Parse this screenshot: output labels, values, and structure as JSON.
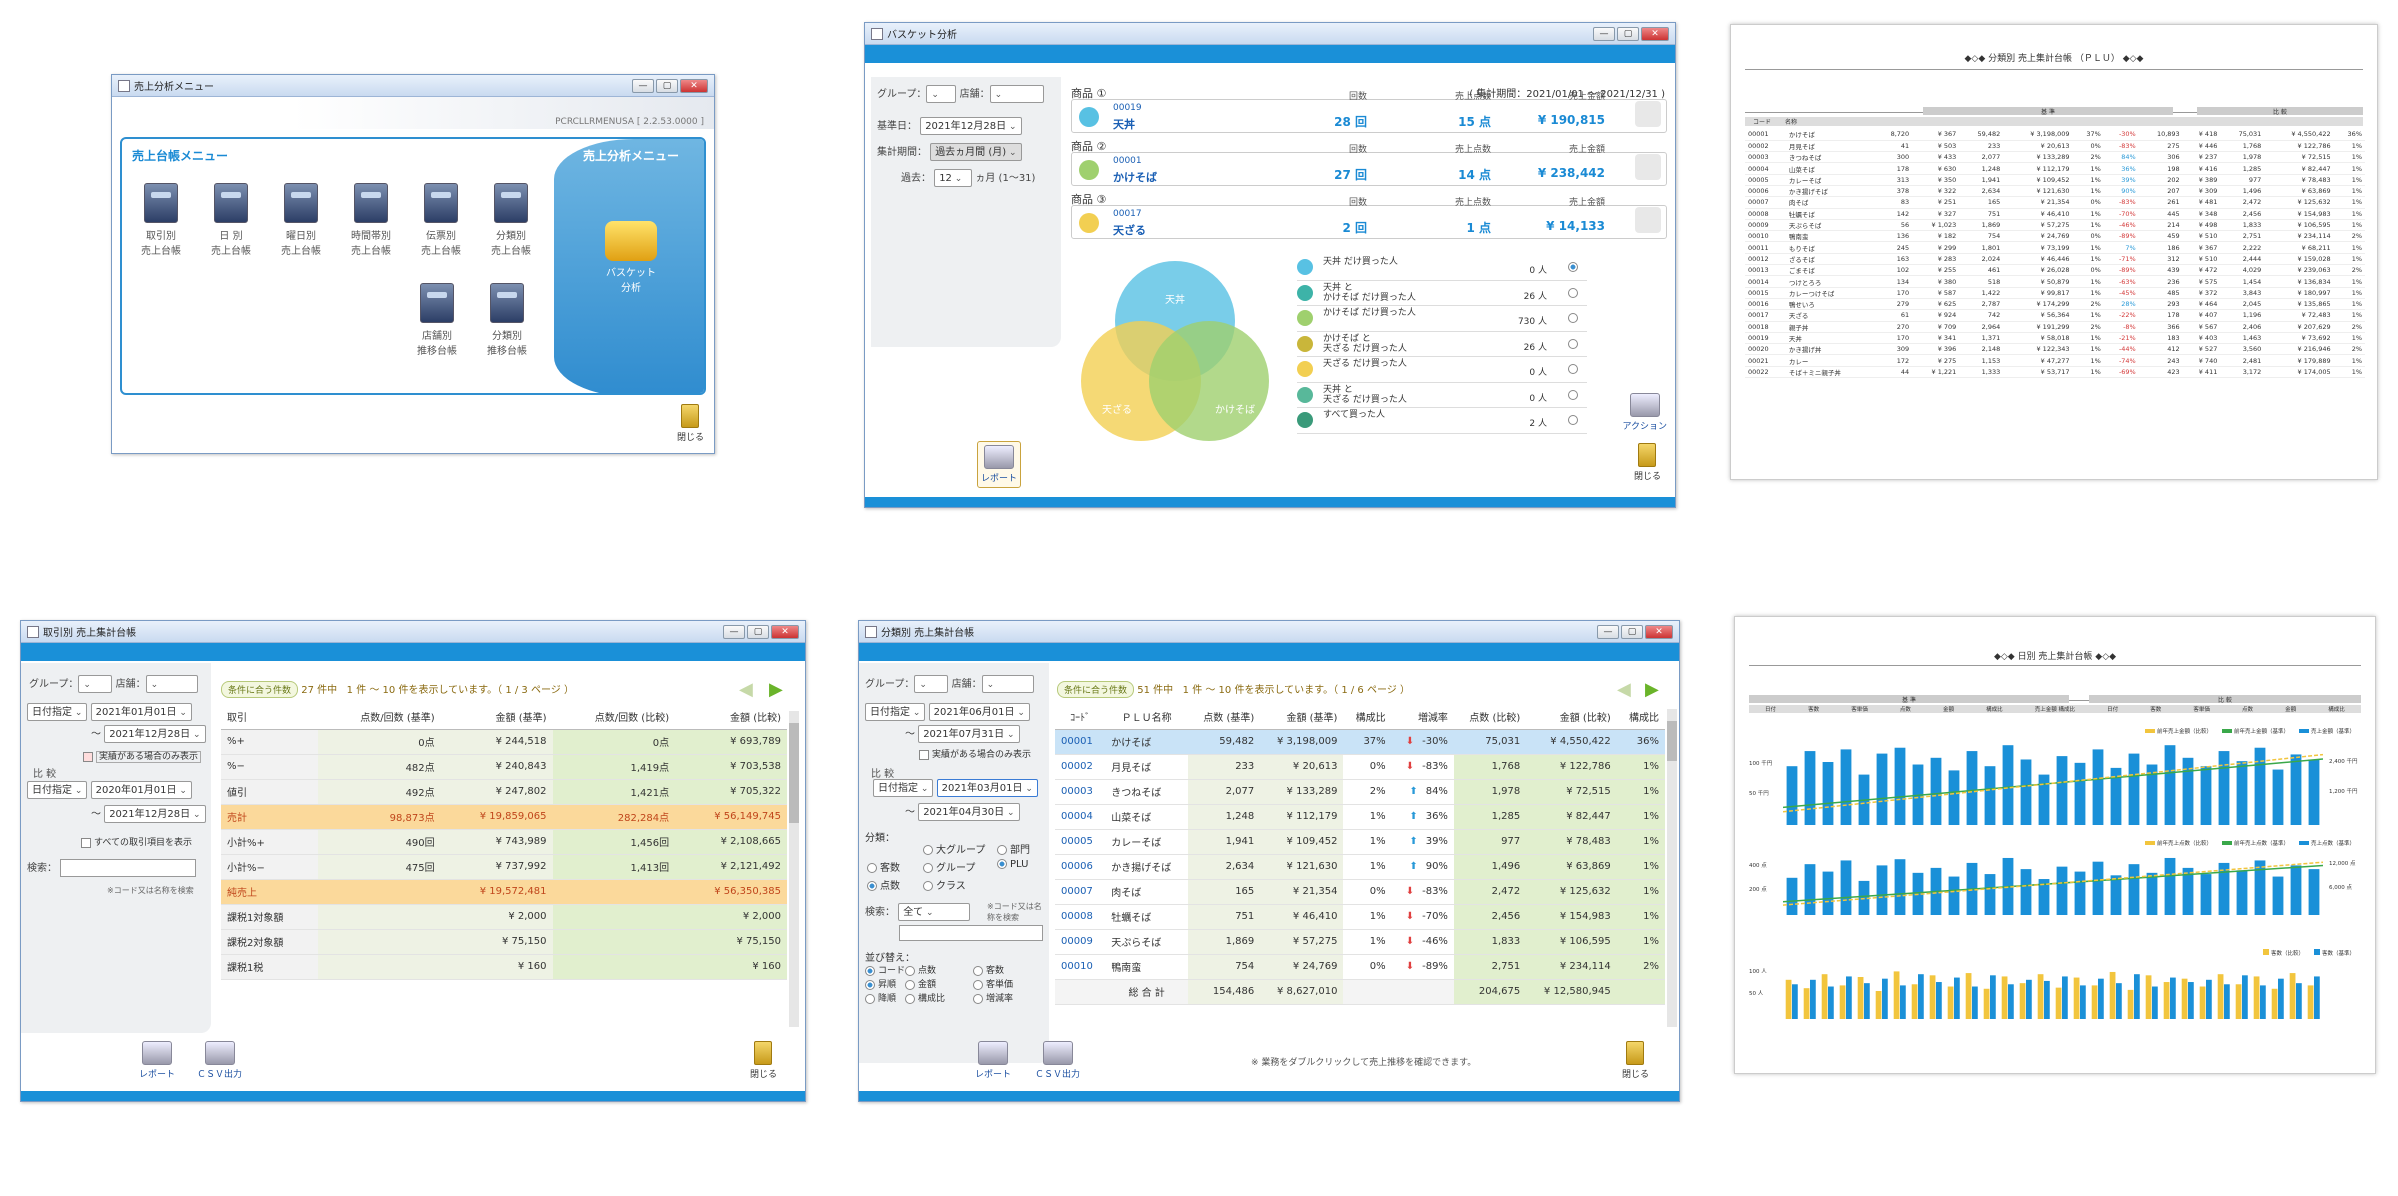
{
  "menu": {
    "title": "売上分析メニュー",
    "version": "PCRCLLRMENUSA [ 2.2.53.0000 ]",
    "section_left": "売上台帳メニュー",
    "section_right": "売上分析メニュー",
    "icons": [
      {
        "l1": "取引別",
        "l2": "売上台帳"
      },
      {
        "l1": "日 別",
        "l2": "売上台帳"
      },
      {
        "l1": "曜日別",
        "l2": "売上台帳"
      },
      {
        "l1": "時間帯別",
        "l2": "売上台帳"
      },
      {
        "l1": "伝票別",
        "l2": "売上台帳"
      },
      {
        "l1": "分類別",
        "l2": "売上台帳"
      }
    ],
    "icons2": [
      {
        "l1": "店舗別",
        "l2": "推移台帳"
      },
      {
        "l1": "分類別",
        "l2": "推移台帳"
      }
    ],
    "basket_l1": "バスケット",
    "basket_l2": "分析",
    "close": "閉じる"
  },
  "basket": {
    "title": "バスケット分析",
    "group": "グループ：",
    "store": "店舗：",
    "base_date_label": "基準日：",
    "base_date": "2021年12月28日",
    "period_label": "集計期間：",
    "period": "過去ヵ月間 (月)",
    "past_label": "過去：",
    "past_value": "12",
    "past_unit": "ヵ月 (1～31)",
    "range": "( 集計期間：2021/01/01 ～ 2021/12/31 )",
    "products": [
      {
        "head": "商品 ①",
        "code": "00019",
        "name": "天丼",
        "k1": "回数",
        "v1": "28 回",
        "k2": "売上点数",
        "v2": "15 点",
        "k3": "売上金額",
        "v3": "¥ 190,815",
        "color": "#58c1e3"
      },
      {
        "head": "商品 ②",
        "code": "00001",
        "name": "かけそば",
        "k1": "回数",
        "v1": "27 回",
        "k2": "売上点数",
        "v2": "14 点",
        "k3": "売上金額",
        "v3": "¥ 238,442",
        "color": "#9fd06e"
      },
      {
        "head": "商品 ③",
        "code": "00017",
        "name": "天ざる",
        "k1": "回数",
        "v1": "2 回",
        "k2": "売上点数",
        "v2": "1 点",
        "k3": "売上金額",
        "v3": "¥ 14,133",
        "color": "#f2cf52"
      }
    ],
    "venn": [
      "天丼",
      "天ざる",
      "かけそば"
    ],
    "rows": [
      {
        "label": "天丼 だけ買った人",
        "count": "0 人",
        "color": "#58c1e3"
      },
      {
        "label": "天丼 と\nかけそば だけ買った人",
        "count": "26 人",
        "color": "#3db3a8"
      },
      {
        "label": "かけそば だけ買った人",
        "count": "730 人",
        "color": "#9fd06e"
      },
      {
        "label": "かけそば と\n天ざる だけ買った人",
        "count": "26 人",
        "color": "#c9b63a"
      },
      {
        "label": "天ざる だけ買った人",
        "count": "0 人",
        "color": "#f2cf52"
      },
      {
        "label": "天丼 と\n天ざる だけ買った人",
        "count": "0 人",
        "color": "#58b89a"
      },
      {
        "label": "すべて買った人",
        "count": "2 人",
        "color": "#3a9a7a"
      }
    ],
    "action": "アクション",
    "report": "レポート",
    "close": "閉じる"
  },
  "plu_report": {
    "title": "◆◇◆ 分類別 売上集計台帳 （ＰＬＵ） ◆◇◆",
    "hdr_base": "基 準",
    "hdr_comp": "比 較",
    "cols": [
      "コード",
      "名称"
    ],
    "rows": [
      [
        "00001",
        "かけそば",
        "8,720",
        "¥ 367",
        "59,482",
        "¥ 3,198,009",
        "37%",
        "-30%",
        "10,893",
        "¥ 418",
        "75,031",
        "¥ 4,550,422",
        "36%"
      ],
      [
        "00002",
        "月見そば",
        "41",
        "¥ 503",
        "233",
        "¥ 20,613",
        "0%",
        "-83%",
        "275",
        "¥ 446",
        "1,768",
        "¥ 122,786",
        "1%"
      ],
      [
        "00003",
        "きつねそば",
        "300",
        "¥ 433",
        "2,077",
        "¥ 133,289",
        "2%",
        "84%",
        "306",
        "¥ 237",
        "1,978",
        "¥ 72,515",
        "1%"
      ],
      [
        "00004",
        "山菜そば",
        "178",
        "¥ 630",
        "1,248",
        "¥ 112,179",
        "1%",
        "36%",
        "198",
        "¥ 416",
        "1,285",
        "¥ 82,447",
        "1%"
      ],
      [
        "00005",
        "カレーそば",
        "313",
        "¥ 350",
        "1,941",
        "¥ 109,452",
        "1%",
        "39%",
        "202",
        "¥ 389",
        "977",
        "¥ 78,483",
        "1%"
      ],
      [
        "00006",
        "かき揚げそば",
        "378",
        "¥ 322",
        "2,634",
        "¥ 121,630",
        "1%",
        "90%",
        "207",
        "¥ 309",
        "1,496",
        "¥ 63,869",
        "1%"
      ],
      [
        "00007",
        "肉そば",
        "83",
        "¥ 251",
        "165",
        "¥ 21,354",
        "0%",
        "-83%",
        "261",
        "¥ 481",
        "2,472",
        "¥ 125,632",
        "1%"
      ],
      [
        "00008",
        "牡蠣そば",
        "142",
        "¥ 327",
        "751",
        "¥ 46,410",
        "1%",
        "-70%",
        "445",
        "¥ 348",
        "2,456",
        "¥ 154,983",
        "1%"
      ],
      [
        "00009",
        "天ぷらそば",
        "56",
        "¥ 1,023",
        "1,869",
        "¥ 57,275",
        "1%",
        "-46%",
        "214",
        "¥ 498",
        "1,833",
        "¥ 106,595",
        "1%"
      ],
      [
        "00010",
        "鴨南蛮",
        "136",
        "¥ 182",
        "754",
        "¥ 24,769",
        "0%",
        "-89%",
        "459",
        "¥ 510",
        "2,751",
        "¥ 234,114",
        "2%"
      ],
      [
        "00011",
        "もりそば",
        "245",
        "¥ 299",
        "1,801",
        "¥ 73,199",
        "1%",
        "7%",
        "186",
        "¥ 367",
        "2,222",
        "¥ 68,211",
        "1%"
      ],
      [
        "00012",
        "ざるそば",
        "163",
        "¥ 283",
        "2,024",
        "¥ 46,446",
        "1%",
        "-71%",
        "312",
        "¥ 510",
        "2,444",
        "¥ 159,028",
        "1%"
      ],
      [
        "00013",
        "ごまそば",
        "102",
        "¥ 255",
        "461",
        "¥ 26,028",
        "0%",
        "-89%",
        "439",
        "¥ 472",
        "4,029",
        "¥ 239,063",
        "2%"
      ],
      [
        "00014",
        "つけとろろ",
        "134",
        "¥ 380",
        "518",
        "¥ 50,879",
        "1%",
        "-63%",
        "236",
        "¥ 575",
        "1,454",
        "¥ 136,834",
        "1%"
      ],
      [
        "00015",
        "カレーつけそば",
        "170",
        "¥ 587",
        "1,422",
        "¥ 99,817",
        "1%",
        "-45%",
        "485",
        "¥ 372",
        "3,843",
        "¥ 180,997",
        "1%"
      ],
      [
        "00016",
        "鴨せいろ",
        "279",
        "¥ 625",
        "2,787",
        "¥ 174,299",
        "2%",
        "28%",
        "293",
        "¥ 464",
        "2,045",
        "¥ 135,865",
        "1%"
      ],
      [
        "00017",
        "天ざる",
        "61",
        "¥ 924",
        "742",
        "¥ 56,364",
        "1%",
        "-22%",
        "178",
        "¥ 407",
        "1,196",
        "¥ 72,483",
        "1%"
      ],
      [
        "00018",
        "親子丼",
        "270",
        "¥ 709",
        "2,964",
        "¥ 191,299",
        "2%",
        "-8%",
        "366",
        "¥ 567",
        "2,406",
        "¥ 207,629",
        "2%"
      ],
      [
        "00019",
        "天丼",
        "170",
        "¥ 341",
        "1,371",
        "¥ 58,018",
        "1%",
        "-21%",
        "183",
        "¥ 403",
        "1,463",
        "¥ 73,692",
        "1%"
      ],
      [
        "00020",
        "かき揚げ丼",
        "309",
        "¥ 396",
        "2,148",
        "¥ 122,343",
        "1%",
        "-44%",
        "412",
        "¥ 527",
        "3,560",
        "¥ 216,946",
        "2%"
      ],
      [
        "00021",
        "カレー",
        "172",
        "¥ 275",
        "1,153",
        "¥ 47,277",
        "1%",
        "-74%",
        "243",
        "¥ 740",
        "2,481",
        "¥ 179,889",
        "1%"
      ],
      [
        "00022",
        "そば＋ミニ親子丼",
        "44",
        "¥ 1,221",
        "1,333",
        "¥ 53,717",
        "1%",
        "-69%",
        "423",
        "¥ 411",
        "3,172",
        "¥ 174,005",
        "1%"
      ]
    ]
  },
  "trade": {
    "title": "取引別 売上集計台帳",
    "group": "グループ：",
    "store": "店舗：",
    "mode1": "日付指定",
    "from1": "2021年01月01日",
    "to1": "2021年12月28日",
    "only": "実績がある場合のみ表示",
    "compare": "比 較",
    "mode2": "日付指定",
    "from2": "2020年01月01日",
    "to2": "2021年12月28日",
    "showall": "すべての取引項目を表示",
    "search": "検索：",
    "hint": "※コード又は名称を検索",
    "chip": "条件に合う件数",
    "count": "27 件中",
    "paging": "1 件 ～ 10 件を表示しています。（ 1 / 3 ページ ）",
    "cols": [
      "取引",
      "点数/回数 (基準)",
      "金額 (基準)",
      "点数/回数 (比較)",
      "金額 (比較)"
    ],
    "rows": [
      [
        "%+",
        "0点",
        "¥ 244,518",
        "0点",
        "¥ 693,789"
      ],
      [
        "%−",
        "482点",
        "¥ 240,843",
        "1,419点",
        "¥ 703,538"
      ],
      [
        "値引",
        "492点",
        "¥ 247,802",
        "1,421点",
        "¥ 705,322"
      ],
      [
        "売計",
        "98,873点",
        "¥ 19,859,065",
        "282,284点",
        "¥ 56,149,745"
      ],
      [
        "小計%+",
        "490回",
        "¥ 743,989",
        "1,456回",
        "¥ 2,108,665"
      ],
      [
        "小計%−",
        "475回",
        "¥ 737,992",
        "1,413回",
        "¥ 2,121,492"
      ],
      [
        "純売上",
        "",
        "¥ 19,572,481",
        "",
        "¥ 56,350,385"
      ],
      [
        "課税1対象額",
        "",
        "¥ 2,000",
        "",
        "¥ 2,000"
      ],
      [
        "課税2対象額",
        "",
        "¥ 75,150",
        "",
        "¥ 75,150"
      ],
      [
        "課税1税",
        "",
        "¥ 160",
        "",
        "¥ 160"
      ]
    ],
    "report": "レポート",
    "csv": "ＣＳＶ出力",
    "close": "閉じる"
  },
  "category": {
    "title": "分類別 売上集計台帳",
    "group": "グループ：",
    "store": "店舗：",
    "mode1": "日付指定",
    "from1": "2021年06月01日",
    "to1": "2021年07月31日",
    "only": "実績がある場合のみ表示",
    "compare": "比 較",
    "mode2": "日付指定",
    "from2": "2021年03月01日",
    "to2": "2021年04月30日",
    "class_label": "分類：",
    "opts": [
      "客数",
      "点数",
      "大グループ",
      "グループ",
      "クラス",
      "部門",
      "PLU"
    ],
    "search": "検索：",
    "search_val": "全て",
    "hint": "※コード又は名称を検索",
    "sort_label": "並び替え：",
    "sort": [
      "コード",
      "点数",
      "金額",
      "構成比",
      "客数",
      "客単価",
      "増減率"
    ],
    "order": [
      "昇順",
      "降順"
    ],
    "chip": "条件に合う件数",
    "count": "51 件中",
    "paging": "1 件 ～ 10 件を表示しています。（ 1 / 6 ページ ）",
    "cols": [
      "ｺｰﾄﾞ",
      "ＰＬＵ名称",
      "点数 (基準)",
      "金額 (基準)",
      "構成比",
      "増減率",
      "点数 (比較)",
      "金額 (比較)",
      "構成比"
    ],
    "rows": [
      [
        "00001",
        "かけそば",
        "59,482",
        "¥ 3,198,009",
        "37%",
        "-30%",
        "75,031",
        "¥ 4,550,422",
        "36%",
        "d"
      ],
      [
        "00002",
        "月見そば",
        "233",
        "¥ 20,613",
        "0%",
        "-83%",
        "1,768",
        "¥ 122,786",
        "1%",
        "d"
      ],
      [
        "00003",
        "きつねそば",
        "2,077",
        "¥ 133,289",
        "2%",
        "84%",
        "1,978",
        "¥ 72,515",
        "1%",
        "u"
      ],
      [
        "00004",
        "山菜そば",
        "1,248",
        "¥ 112,179",
        "1%",
        "36%",
        "1,285",
        "¥ 82,447",
        "1%",
        "u"
      ],
      [
        "00005",
        "カレーそば",
        "1,941",
        "¥ 109,452",
        "1%",
        "39%",
        "977",
        "¥ 78,483",
        "1%",
        "u"
      ],
      [
        "00006",
        "かき揚げそば",
        "2,634",
        "¥ 121,630",
        "1%",
        "90%",
        "1,496",
        "¥ 63,869",
        "1%",
        "u"
      ],
      [
        "00007",
        "肉そば",
        "165",
        "¥ 21,354",
        "0%",
        "-83%",
        "2,472",
        "¥ 125,632",
        "1%",
        "d"
      ],
      [
        "00008",
        "牡蠣そば",
        "751",
        "¥ 46,410",
        "1%",
        "-70%",
        "2,456",
        "¥ 154,983",
        "1%",
        "d"
      ],
      [
        "00009",
        "天ぷらそば",
        "1,869",
        "¥ 57,275",
        "1%",
        "-46%",
        "1,833",
        "¥ 106,595",
        "1%",
        "d"
      ],
      [
        "00010",
        "鴨南蛮",
        "754",
        "¥ 24,769",
        "0%",
        "-89%",
        "2,751",
        "¥ 234,114",
        "2%",
        "d"
      ]
    ],
    "total_label": "総 合 計",
    "total": [
      "154,486",
      "¥ 8,627,010",
      "204,675",
      "¥ 12,580,945"
    ],
    "note": "※ 業務をダブルクリックして売上推移を確認できます。",
    "report": "レポート",
    "csv": "ＣＳＶ出力",
    "close": "閉じる"
  },
  "daily_report": {
    "title": "◆◇◆ 日別 売上集計台帳 ◆◇◆",
    "hdr_base": "基 準",
    "hdr_comp": "比 較",
    "cols": [
      "日付",
      "客数",
      "客単価",
      "点数",
      "金額",
      "構成比",
      "売上金額 構成比",
      "日付",
      "客数",
      "客単価",
      "点数",
      "金額",
      "構成比"
    ],
    "legend1": [
      "前年売上金額（比較）",
      "前年売上金額（基準）",
      "売上金額（基準）"
    ],
    "legend2": [
      "前年売上点数（比較）",
      "前年売上点数（基準）",
      "売上点数（基準）"
    ],
    "legend3": [
      "客数（比較）",
      "客数（基準）"
    ],
    "chart1_y": [
      "100 千円",
      "50 千円"
    ],
    "chart1_y2": [
      "2,400 千円",
      "1,200 千円"
    ],
    "chart2_y": [
      "400 点",
      "200 点"
    ],
    "chart2_y2": [
      "12,000 点",
      "6,000 点"
    ],
    "chart3_y": [
      "100 人",
      "50 人"
    ],
    "chart1": [
      70,
      88,
      75,
      90,
      60,
      85,
      92,
      72,
      80,
      65,
      88,
      70,
      95,
      78,
      60,
      82,
      74,
      90,
      68,
      85,
      72,
      95,
      80,
      70,
      88,
      76,
      92,
      66,
      84,
      78
    ],
    "chart2": [
      60,
      82,
      70,
      88,
      55,
      80,
      90,
      68,
      76,
      62,
      84,
      66,
      92,
      74,
      58,
      78,
      70,
      86,
      64,
      82,
      68,
      92,
      76,
      66,
      84,
      72,
      88,
      62,
      80,
      74
    ],
    "chart3a": [
      70,
      55,
      80,
      60,
      75,
      50,
      85,
      62,
      78,
      58,
      82,
      54,
      76,
      64,
      80,
      56,
      74,
      60,
      84,
      52,
      78,
      66,
      72,
      58,
      80,
      62,
      76,
      54,
      82,
      60
    ],
    "chart3b": [
      62,
      70,
      58,
      76,
      64,
      72,
      60,
      80,
      66,
      74,
      58,
      78,
      62,
      70,
      68,
      76,
      60,
      72,
      64,
      80,
      58,
      74,
      66,
      70,
      62,
      78,
      60,
      72,
      64,
      76
    ]
  }
}
